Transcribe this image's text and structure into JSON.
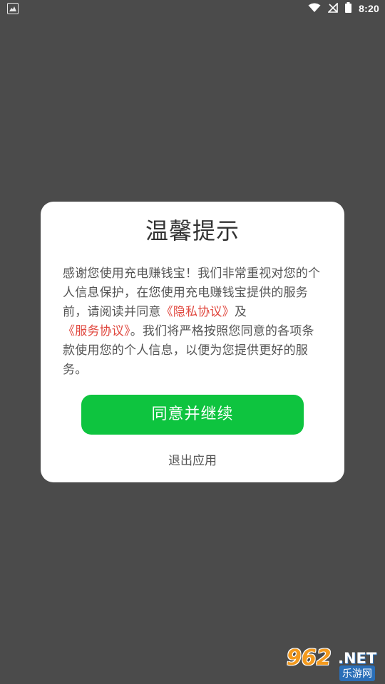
{
  "status_bar": {
    "time": "8:20",
    "icons": [
      "app-notification-icon",
      "wifi-icon",
      "no-sim-icon",
      "battery-icon"
    ]
  },
  "dialog": {
    "title": "温馨提示",
    "body_parts": {
      "part1": "感谢您使用充电赚钱宝！我们非常重视对您的个人信息保护，在您使用充电赚钱宝提供的服务前，请阅读并同意",
      "privacy_link": "《隐私协议》",
      "part2": "及",
      "service_link": "《服务协议》",
      "part3": "。我们将严格按照您同意的各项条款使用您的个人信息，以便为您提供更好的服务。"
    },
    "agree_button": "同意并继续",
    "exit_link": "退出应用"
  },
  "colors": {
    "overlay": "#4b4b4b",
    "accent_green": "#0ec43f",
    "link_red": "#e0473e"
  },
  "watermark": {
    "number": "962",
    "domain": ".NET",
    "subtitle": "乐游网"
  }
}
